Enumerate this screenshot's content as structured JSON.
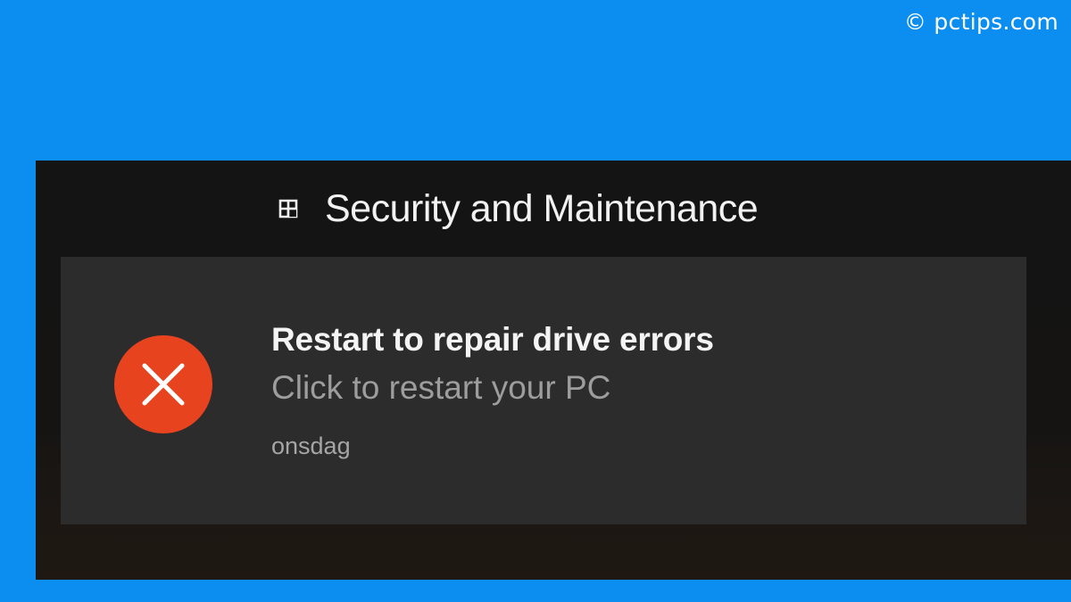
{
  "watermark": {
    "text": "© pctips.com"
  },
  "notification_group": {
    "title": "Security and Maintenance",
    "icon": "security-maintenance-flag-icon"
  },
  "toast": {
    "status_icon": "error-x-circle-icon",
    "status_color": "#e8431f",
    "title": "Restart to repair drive errors",
    "body": "Click to restart your PC",
    "timestamp": "onsdag"
  },
  "colors": {
    "background": "#0b8ef0",
    "panel": "#141414",
    "toast": "#2c2c2c"
  }
}
